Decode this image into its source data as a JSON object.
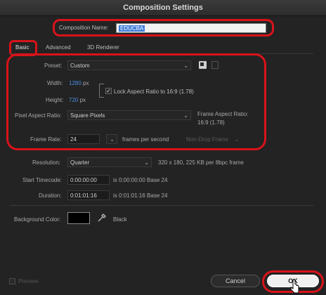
{
  "window": {
    "title": "Composition Settings"
  },
  "comp_name": {
    "label": "Composition Name:",
    "value": "EDUCBA"
  },
  "tabs": [
    {
      "label": "Basic"
    },
    {
      "label": "Advanced"
    },
    {
      "label": "3D Renderer"
    }
  ],
  "preset": {
    "label": "Preset:",
    "value": "Custom"
  },
  "width": {
    "label": "Width:",
    "value": "1280",
    "unit": "px"
  },
  "height": {
    "label": "Height:",
    "value": "720",
    "unit": "px"
  },
  "lock_aspect": {
    "label": "Lock Aspect Ratio to 16:9 (1.78)",
    "checked": true
  },
  "pixel_aspect": {
    "label": "Pixel Aspect Ratio:",
    "value": "Square Pixels"
  },
  "frame_aspect": {
    "label": "Frame Aspect Ratio:",
    "value": "16:9 (1.78)"
  },
  "frame_rate": {
    "label": "Frame Rate:",
    "value": "24",
    "unit": "frames per second",
    "drop_frame": "Non-Drop Frame"
  },
  "resolution": {
    "label": "Resolution:",
    "value": "Quarter",
    "info": "320 x 180, 225 KB per 8bpc frame"
  },
  "start_timecode": {
    "label": "Start Timecode:",
    "value": "0:00:00:00",
    "info": "is 0:00:00:00  Base 24"
  },
  "duration": {
    "label": "Duration:",
    "value": "0:01:01:16",
    "info": "is 0:01:01:16  Base 24"
  },
  "background": {
    "label": "Background Color:",
    "name": "Black",
    "color": "#000000"
  },
  "footer": {
    "preview": "Preview",
    "cancel": "Cancel",
    "ok": "OK"
  },
  "colors": {
    "highlight": "#d8131a",
    "accent": "#4a8ce0"
  }
}
